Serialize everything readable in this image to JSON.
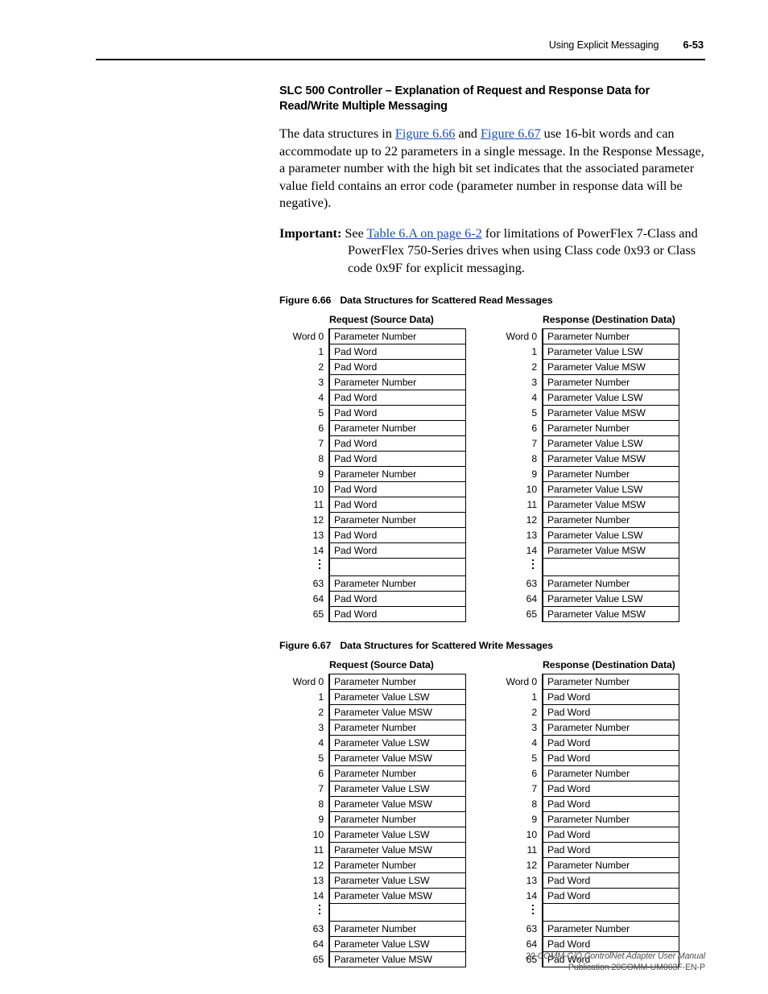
{
  "header": {
    "title": "Using Explicit Messaging",
    "page_number": "6-53"
  },
  "section": {
    "title": "SLC 500 Controller – Explanation of Request and Response Data for Read/Write Multiple Messaging",
    "paragraph": {
      "part1": "The data structures in ",
      "link1": "Figure 6.66",
      "part2": " and ",
      "link2": "Figure 6.67",
      "part3": " use 16-bit words and can accommodate up to 22 parameters in a single message. In the Response Message, a parameter number with the high bit set indicates that the associated parameter value field contains an error code (parameter number in response data will be negative)."
    },
    "important": {
      "label": "Important:",
      "part1": " See ",
      "link": "Table 6.A on page 6-2",
      "part2": " for limitations of PowerFlex 7-Class and PowerFlex 750-Series drives when using Class code 0x93 or Class code 0x9F for explicit messaging."
    }
  },
  "figures": [
    {
      "number": "Figure 6.66",
      "caption": "Data Structures for Scattered Read Messages",
      "request": {
        "heading": "Request (Source Data)",
        "rows": [
          {
            "label": "Word 0",
            "value": "Parameter Number"
          },
          {
            "label": "1",
            "value": "Pad Word"
          },
          {
            "label": "2",
            "value": "Pad Word"
          },
          {
            "label": "3",
            "value": "Parameter Number"
          },
          {
            "label": "4",
            "value": "Pad Word"
          },
          {
            "label": "5",
            "value": "Pad Word"
          },
          {
            "label": "6",
            "value": "Parameter Number"
          },
          {
            "label": "7",
            "value": "Pad Word"
          },
          {
            "label": "8",
            "value": "Pad Word"
          },
          {
            "label": "9",
            "value": "Parameter Number"
          },
          {
            "label": "10",
            "value": "Pad Word"
          },
          {
            "label": "11",
            "value": "Pad Word"
          },
          {
            "label": "12",
            "value": "Parameter Number"
          },
          {
            "label": "13",
            "value": "Pad Word"
          },
          {
            "label": "14",
            "value": "Pad Word"
          },
          {
            "label": "⋮",
            "value": ""
          },
          {
            "label": "63",
            "value": "Parameter Number"
          },
          {
            "label": "64",
            "value": "Pad Word"
          },
          {
            "label": "65",
            "value": "Pad Word"
          }
        ]
      },
      "response": {
        "heading": "Response (Destination Data)",
        "rows": [
          {
            "label": "Word 0",
            "value": "Parameter Number"
          },
          {
            "label": "1",
            "value": "Parameter Value LSW"
          },
          {
            "label": "2",
            "value": "Parameter Value MSW"
          },
          {
            "label": "3",
            "value": "Parameter Number"
          },
          {
            "label": "4",
            "value": "Parameter Value LSW"
          },
          {
            "label": "5",
            "value": "Parameter Value MSW"
          },
          {
            "label": "6",
            "value": "Parameter Number"
          },
          {
            "label": "7",
            "value": "Parameter Value LSW"
          },
          {
            "label": "8",
            "value": "Parameter Value MSW"
          },
          {
            "label": "9",
            "value": "Parameter Number"
          },
          {
            "label": "10",
            "value": "Parameter Value LSW"
          },
          {
            "label": "11",
            "value": "Parameter Value MSW"
          },
          {
            "label": "12",
            "value": "Parameter Number"
          },
          {
            "label": "13",
            "value": "Parameter Value LSW"
          },
          {
            "label": "14",
            "value": "Parameter Value MSW"
          },
          {
            "label": "⋮",
            "value": ""
          },
          {
            "label": "63",
            "value": "Parameter Number"
          },
          {
            "label": "64",
            "value": "Parameter Value LSW"
          },
          {
            "label": "65",
            "value": "Parameter Value MSW"
          }
        ]
      }
    },
    {
      "number": "Figure 6.67",
      "caption": "Data Structures for Scattered Write Messages",
      "request": {
        "heading": "Request (Source Data)",
        "rows": [
          {
            "label": "Word 0",
            "value": "Parameter Number"
          },
          {
            "label": "1",
            "value": "Parameter Value LSW"
          },
          {
            "label": "2",
            "value": "Parameter Value MSW"
          },
          {
            "label": "3",
            "value": "Parameter Number"
          },
          {
            "label": "4",
            "value": "Parameter Value LSW"
          },
          {
            "label": "5",
            "value": "Parameter Value MSW"
          },
          {
            "label": "6",
            "value": "Parameter Number"
          },
          {
            "label": "7",
            "value": "Parameter Value LSW"
          },
          {
            "label": "8",
            "value": "Parameter Value MSW"
          },
          {
            "label": "9",
            "value": "Parameter Number"
          },
          {
            "label": "10",
            "value": "Parameter Value LSW"
          },
          {
            "label": "11",
            "value": "Parameter Value MSW"
          },
          {
            "label": "12",
            "value": "Parameter Number"
          },
          {
            "label": "13",
            "value": "Parameter Value LSW"
          },
          {
            "label": "14",
            "value": "Parameter Value MSW"
          },
          {
            "label": "⋮",
            "value": ""
          },
          {
            "label": "63",
            "value": "Parameter Number"
          },
          {
            "label": "64",
            "value": "Parameter Value LSW"
          },
          {
            "label": "65",
            "value": "Parameter Value MSW"
          }
        ]
      },
      "response": {
        "heading": "Response (Destination Data)",
        "rows": [
          {
            "label": "Word 0",
            "value": "Parameter Number"
          },
          {
            "label": "1",
            "value": "Pad Word"
          },
          {
            "label": "2",
            "value": "Pad Word"
          },
          {
            "label": "3",
            "value": "Parameter Number"
          },
          {
            "label": "4",
            "value": "Pad Word"
          },
          {
            "label": "5",
            "value": "Pad Word"
          },
          {
            "label": "6",
            "value": "Parameter Number"
          },
          {
            "label": "7",
            "value": "Pad Word"
          },
          {
            "label": "8",
            "value": "Pad Word"
          },
          {
            "label": "9",
            "value": "Parameter Number"
          },
          {
            "label": "10",
            "value": "Pad Word"
          },
          {
            "label": "11",
            "value": "Pad Word"
          },
          {
            "label": "12",
            "value": "Parameter Number"
          },
          {
            "label": "13",
            "value": "Pad Word"
          },
          {
            "label": "14",
            "value": "Pad Word"
          },
          {
            "label": "⋮",
            "value": ""
          },
          {
            "label": "63",
            "value": "Parameter Number"
          },
          {
            "label": "64",
            "value": "Pad Word"
          },
          {
            "label": "65",
            "value": "Pad Word"
          }
        ]
      }
    }
  ],
  "footer": {
    "line1": "20-COMM-C/Q ControlNet Adapter User Manual",
    "line2": "Publication 20COMM-UM003F-EN-P"
  }
}
